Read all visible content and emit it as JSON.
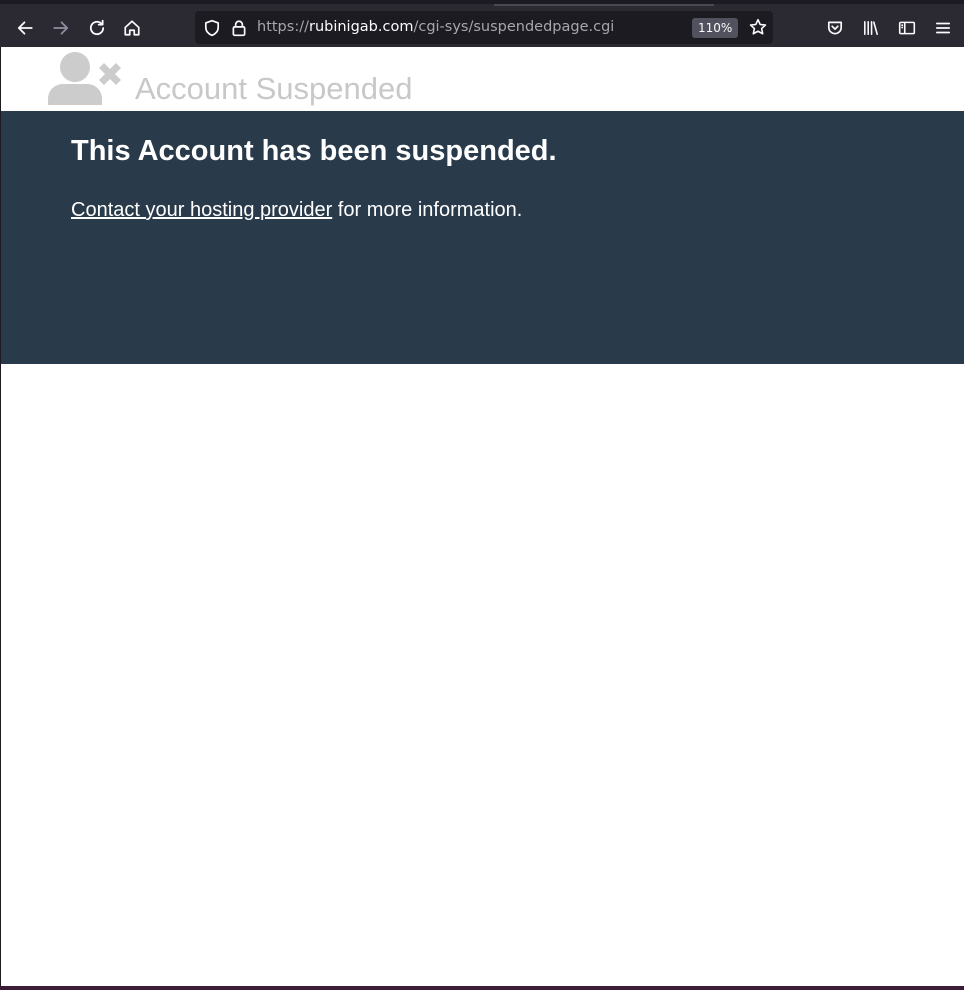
{
  "browser": {
    "url": {
      "scheme": "https://",
      "host": "rubinigab.com",
      "path": "/cgi-sys/suspendedpage.cgi"
    },
    "zoom": "110%",
    "icons": {
      "back": "arrow-left-icon",
      "forward": "arrow-right-icon",
      "reload": "reload-icon",
      "home": "home-icon",
      "tracking": "shield-icon",
      "security": "lock-icon",
      "bookmark": "star-icon",
      "pocket": "pocket-icon",
      "library": "library-icon",
      "sidebar": "sidebar-icon",
      "menu": "hamburger-menu-icon"
    }
  },
  "page": {
    "brand": "Account Suspended",
    "heading": "This Account has been suspended.",
    "contact_link": "Contact your hosting provider",
    "contact_suffix": " for more information."
  },
  "colors": {
    "banner": "#293a4a",
    "brand_text": "#c8c8c8",
    "toolbar": "#2b2a33"
  }
}
